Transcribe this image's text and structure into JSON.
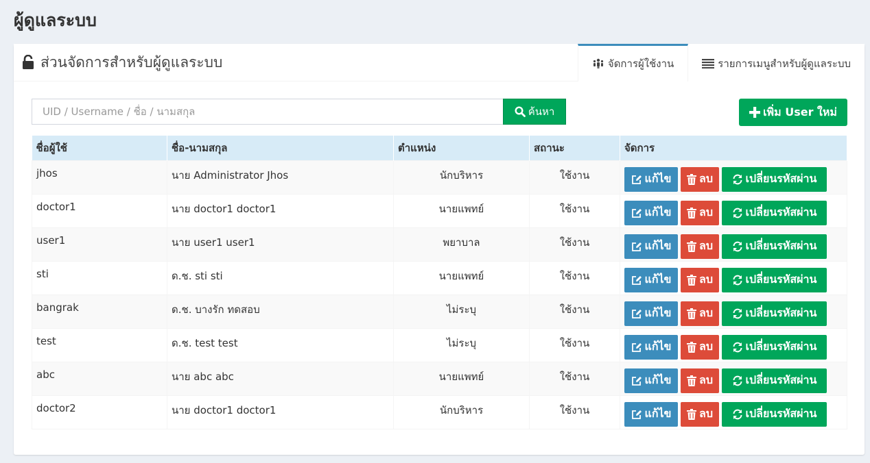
{
  "page": {
    "title": "ผู้ดูแลระบบ"
  },
  "panel": {
    "title": "ส่วนจัดการสำหรับผู้ดูแลระบบ",
    "tabs": [
      {
        "label": "จัดการผู้ใช้งาน",
        "icon": "users-icon",
        "active": true
      },
      {
        "label": "รายการเมนูสำหรับผู้ดูแลระบบ",
        "icon": "list-icon",
        "active": false
      }
    ]
  },
  "search": {
    "placeholder": "UID / Username / ชื่อ / นามสกุล",
    "value": "",
    "button_label": "ค้นหา"
  },
  "add_button": {
    "label": "เพิ่ม User ใหม่"
  },
  "table": {
    "columns": [
      "ชื่อผู้ใช้",
      "ชื่อ-นามสกุล",
      "ตำแหน่ง",
      "สถานะ",
      "จัดการ"
    ],
    "rows": [
      {
        "username": "jhos",
        "fullname": "นาย Administrator Jhos",
        "position": "นักบริหาร",
        "status": "ใช้งาน"
      },
      {
        "username": "doctor1",
        "fullname": "นาย doctor1 doctor1",
        "position": "นายแพทย์",
        "status": "ใช้งาน"
      },
      {
        "username": "user1",
        "fullname": "นาย user1 user1",
        "position": "พยาบาล",
        "status": "ใช้งาน"
      },
      {
        "username": "sti",
        "fullname": "ด.ช. sti sti",
        "position": "นายแพทย์",
        "status": "ใช้งาน"
      },
      {
        "username": "bangrak",
        "fullname": "ด.ช. บางรัก ทดสอบ",
        "position": "ไม่ระบุ",
        "status": "ใช้งาน"
      },
      {
        "username": "test",
        "fullname": "ด.ช. test test",
        "position": "ไม่ระบุ",
        "status": "ใช้งาน"
      },
      {
        "username": "abc",
        "fullname": "นาย abc abc",
        "position": "นายแพทย์",
        "status": "ใช้งาน"
      },
      {
        "username": "doctor2",
        "fullname": "นาย doctor1 doctor1",
        "position": "นักบริหาร",
        "status": "ใช้งาน"
      }
    ],
    "actions": {
      "edit": "แก้ไข",
      "delete": "ลบ",
      "change_password": "เปลี่ยนรหัสผ่าน"
    }
  },
  "colors": {
    "background": "#ecf0f5",
    "primary": "#3c8dbc",
    "success": "#00a65a",
    "danger": "#dd4b39",
    "table_header": "#d7ebf7"
  }
}
